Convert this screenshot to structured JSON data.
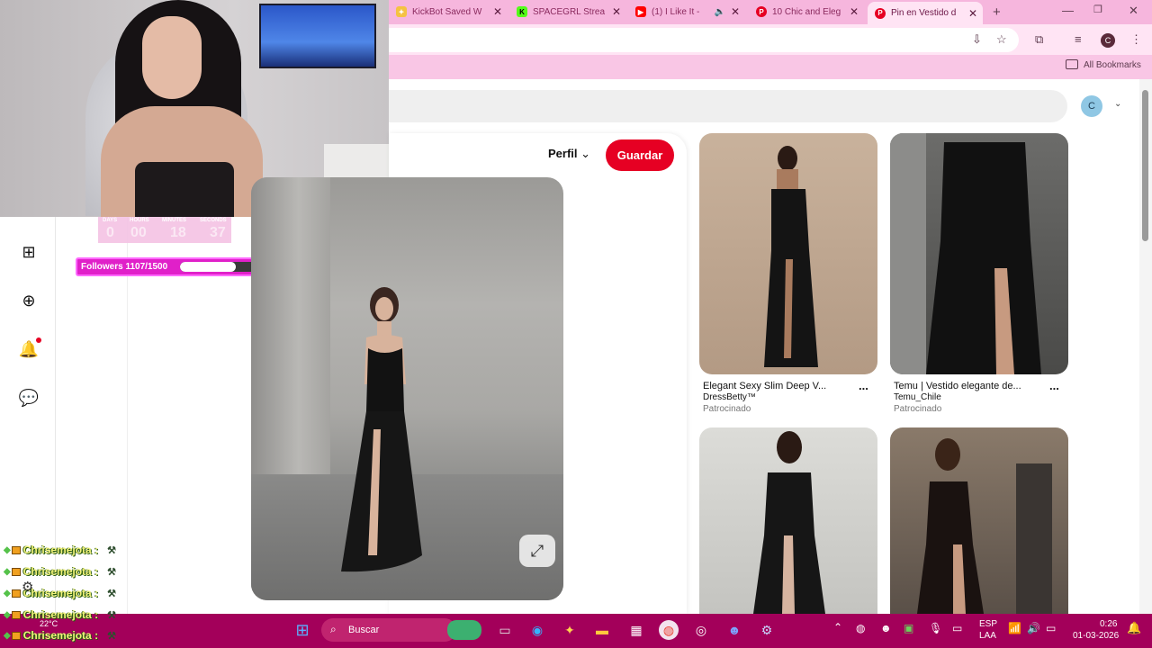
{
  "browser": {
    "tabs": [
      {
        "title": "KickBot Saved W",
        "favicon": "kickbot-icon",
        "color": "#f5c242"
      },
      {
        "title": "SPACEGRL Strea",
        "favicon": "kick-icon",
        "color": "#53fc18"
      },
      {
        "title": "(1) I Like It -",
        "favicon": "youtube-icon",
        "color": "#ff0000"
      },
      {
        "title": "10 Chic and Eleg",
        "favicon": "pinterest-icon",
        "color": "#e60023"
      },
      {
        "title": "Pin en Vestido d",
        "favicon": "pinterest-icon",
        "color": "#e60023"
      }
    ],
    "new_tab": "+",
    "bookmarks_label": "All Bookmarks",
    "profile_initial": "C"
  },
  "stream": {
    "timer_labels": [
      "DAYS",
      "HOURS",
      "MINUTES",
      "SECONDS"
    ],
    "timer_values": [
      "0",
      "00",
      "18",
      "37"
    ],
    "followers_label": "Followers 1107/1500",
    "followers_progress": 0.738
  },
  "pinterest": {
    "avatar_initial": "C",
    "perfil_label": "Perfil",
    "save_label": "Guardar",
    "grid": [
      {
        "title": "Elegant Sexy Slim Deep V...",
        "source": "DressBetty™",
        "sponsored": "Patrocinado",
        "more": "..."
      },
      {
        "title": "Temu | Vestido elegante de...",
        "source": "Temu_Chile",
        "sponsored": "Patrocinado",
        "more": "..."
      }
    ]
  },
  "chat": {
    "username": "Chrisemejota :",
    "count": 5
  },
  "taskbar": {
    "search_placeholder": "Buscar",
    "weather": "22°C",
    "lang_top": "ESP",
    "lang_bottom": "LAA",
    "time": "0:26",
    "date": "01-03-2026",
    "accent": "#a3005a"
  }
}
